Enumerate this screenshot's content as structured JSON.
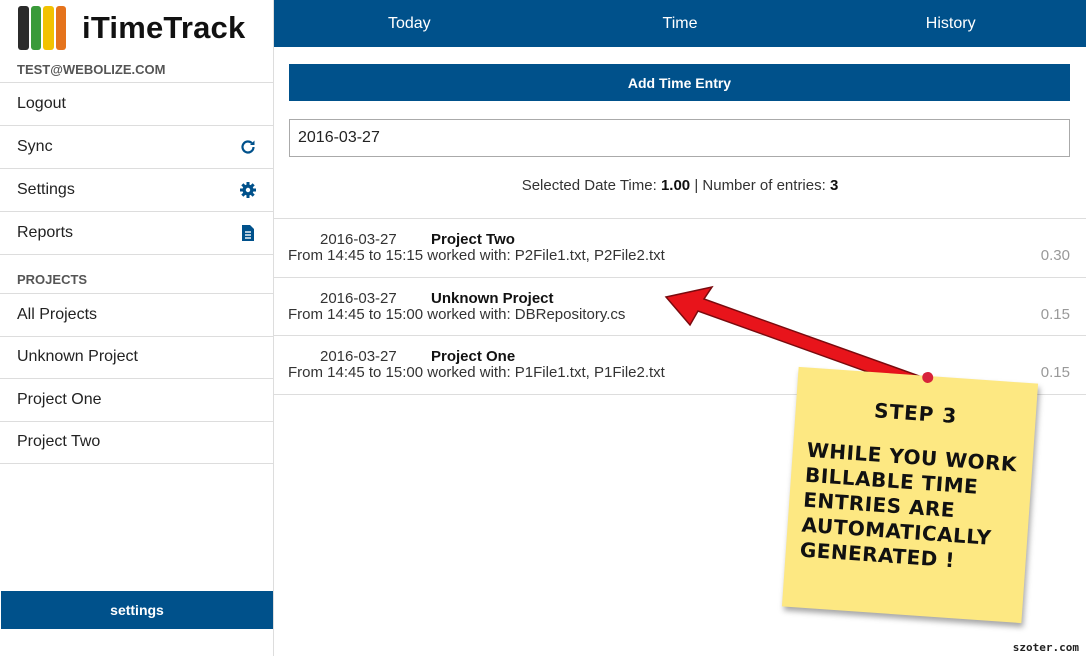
{
  "app": {
    "name": "iTimeTrack"
  },
  "sidebar": {
    "email": "TEST@WEBOLIZE.COM",
    "menu": [
      {
        "label": "Logout",
        "icon": ""
      },
      {
        "label": "Sync",
        "icon": "refresh-icon"
      },
      {
        "label": "Settings",
        "icon": "gear-icon"
      },
      {
        "label": "Reports",
        "icon": "document-icon"
      }
    ],
    "projects_label": "PROJECTS",
    "projects": [
      "All Projects",
      "Unknown Project",
      "Project One",
      "Project Two"
    ],
    "settings_button": "settings"
  },
  "nav": {
    "tabs": [
      "Today",
      "Time",
      "History"
    ]
  },
  "main": {
    "add_button": "Add Time Entry",
    "date_value": "2016-03-27",
    "summary": {
      "date_label": "Selected Date Time:",
      "date_time": "1.00",
      "entries_label": "| Number of entries:",
      "entries_count": "3"
    },
    "entries": [
      {
        "date": "2016-03-27",
        "project": "Project Two",
        "desc": "From 14:45 to 15:15 worked with: P2File1.txt, P2File2.txt",
        "hours": "0.30"
      },
      {
        "date": "2016-03-27",
        "project": "Unknown Project",
        "desc": "From 14:45 to 15:00 worked with: DBRepository.cs",
        "hours": "0.15"
      },
      {
        "date": "2016-03-27",
        "project": "Project One",
        "desc": "From 14:45 to 15:00 worked with: P1File1.txt, P1File2.txt",
        "hours": "0.15"
      }
    ]
  },
  "annotation": {
    "title": "STEP 3",
    "body": "WHILE YOU WORK BILLABLE TIME ENTRIES ARE AUTOMATICALLY GENERATED !"
  },
  "watermark": "szoter.com",
  "colors": {
    "primary": "#00518b",
    "sticky": "#fde882",
    "arrow": "#e8141b"
  }
}
